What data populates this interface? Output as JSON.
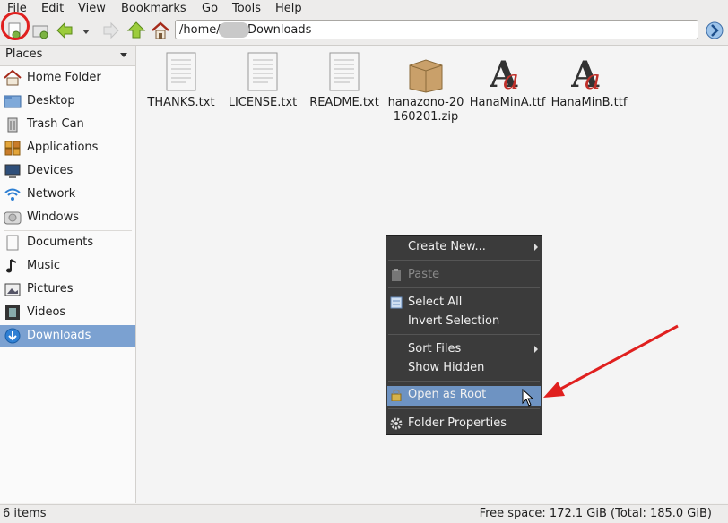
{
  "menubar": {
    "items": [
      "File",
      "Edit",
      "View",
      "Bookmarks",
      "Go",
      "Tools",
      "Help"
    ]
  },
  "toolbar": {
    "buttons": [
      "new-tab-icon",
      "new-window-icon",
      "back-arrow-icon",
      "history-dropdown-icon",
      "forward-arrow-icon",
      "up-arrow-icon",
      "home-icon"
    ],
    "address": "/home/  /Downloads",
    "go_icon": "go-icon"
  },
  "side_pane": {
    "header": "Places",
    "items": [
      {
        "label": "Home Folder",
        "icon": "home-folder-icon"
      },
      {
        "label": "Desktop",
        "icon": "desktop-folder-icon"
      },
      {
        "label": "Trash Can",
        "icon": "trash-icon"
      },
      {
        "label": "Applications",
        "icon": "applications-icon"
      },
      {
        "label": "Devices",
        "icon": "devices-icon"
      },
      {
        "label": "Network",
        "icon": "network-icon"
      },
      {
        "label": "Windows",
        "icon": "drive-icon"
      },
      {
        "label": "Documents",
        "icon": "documents-icon"
      },
      {
        "label": "Music",
        "icon": "music-icon"
      },
      {
        "label": "Pictures",
        "icon": "pictures-icon"
      },
      {
        "label": "Videos",
        "icon": "videos-icon"
      },
      {
        "label": "Downloads",
        "icon": "downloads-icon",
        "selected": true
      }
    ]
  },
  "files": [
    {
      "name": "THANKS.txt",
      "icon": "text-file-icon"
    },
    {
      "name": "LICENSE.txt",
      "icon": "text-file-icon"
    },
    {
      "name": "README.txt",
      "icon": "text-file-icon"
    },
    {
      "name": "hanazono-20\n160201.zip",
      "icon": "archive-icon"
    },
    {
      "name": "HanaMinA.ttf",
      "icon": "font-file-icon"
    },
    {
      "name": "HanaMinB.ttf",
      "icon": "font-file-icon"
    }
  ],
  "context_menu": {
    "items": [
      {
        "label": "Create New...",
        "submenu": true
      },
      {
        "label": "Paste",
        "disabled": true,
        "icon": "paste-icon"
      },
      {
        "label": "Select All",
        "icon": "select-all-icon"
      },
      {
        "label": "Invert Selection"
      },
      {
        "label": "Sort Files",
        "submenu": true
      },
      {
        "label": "Show Hidden"
      },
      {
        "label": "Open as Root",
        "icon": "lock-icon",
        "highlighted": true
      },
      {
        "label": "Folder Properties",
        "icon": "gear-icon"
      }
    ]
  },
  "status": {
    "left": "6 items",
    "right": "Free space: 172.1 GiB (Total: 185.0 GiB)"
  },
  "colors": {
    "selection": "#7ba1d1",
    "menu_bg": "#3b3b3b",
    "menu_highlight": "#6e93c2",
    "annotation": "#e0201f"
  }
}
